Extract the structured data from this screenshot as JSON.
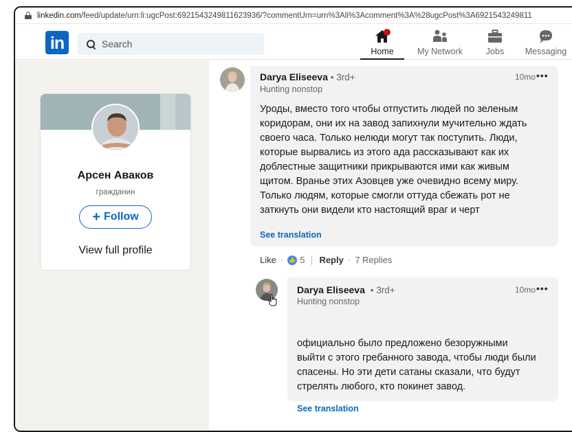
{
  "browser": {
    "url_host": "linkedin.com",
    "url_path": "/feed/update/urn:li:ugcPost:6921543249811623936/?commentUrn=urn%3Ali%3Acomment%3A%28ugcPost%3A6921543249811"
  },
  "nav": {
    "logo": "in",
    "search_placeholder": "Search",
    "items": [
      {
        "label": "Home",
        "icon": "home-icon",
        "active": true
      },
      {
        "label": "My Network",
        "icon": "network-icon",
        "active": false
      },
      {
        "label": "Jobs",
        "icon": "briefcase-icon",
        "active": false
      },
      {
        "label": "Messaging",
        "icon": "messaging-icon",
        "active": false
      }
    ]
  },
  "profile": {
    "name": "Арсен Аваков",
    "headline": "гражданин",
    "follow_label": "Follow",
    "view_profile": "View full profile"
  },
  "comments": [
    {
      "author": "Darya Eliseeva",
      "degree": "• 3rd+",
      "headline": "Hunting nonstop",
      "time": "10mo",
      "more": "•••",
      "lines": [
        "Уроды, вместо того чтобы отпустить людей по зеленым",
        "коридорам, они их на завод запихнули мучительно ждать",
        "своего часа. Только нелюди могут так поступить. Люди,",
        "которые вырвались из этого ада рассказывают как их",
        "доблестные защитники прикрываются ими как живым",
        "щитом. Вранье этих Азовцев уже очевидно всему миру.",
        "Только людям, которые смогли оттуда сбежать рот не",
        "заткнуть они видели кто настоящий враг и черт"
      ],
      "see_translation": "See translation",
      "like_label": "Like",
      "reactions": "5",
      "reply_label": "Reply",
      "replies": "7 Replies"
    },
    {
      "author": "Darya Eliseeva",
      "degree": "• 3rd+",
      "headline": "Hunting nonstop",
      "time": "10mo",
      "more": "•••",
      "lines": [
        "официально было предложено безоружными",
        "выйти с этого гребанного завода, чтобы люди были",
        "спасены. Но эти дети сатаны сказали, что будут",
        "стрелять любого, кто покинет завод."
      ],
      "see_translation": "See translation"
    }
  ],
  "colors": {
    "linkedin_blue": "#0a66c2",
    "notification_red": "#cc1016",
    "page_bg": "#f3f2ef",
    "bubble_bg": "#f2f2f2"
  }
}
